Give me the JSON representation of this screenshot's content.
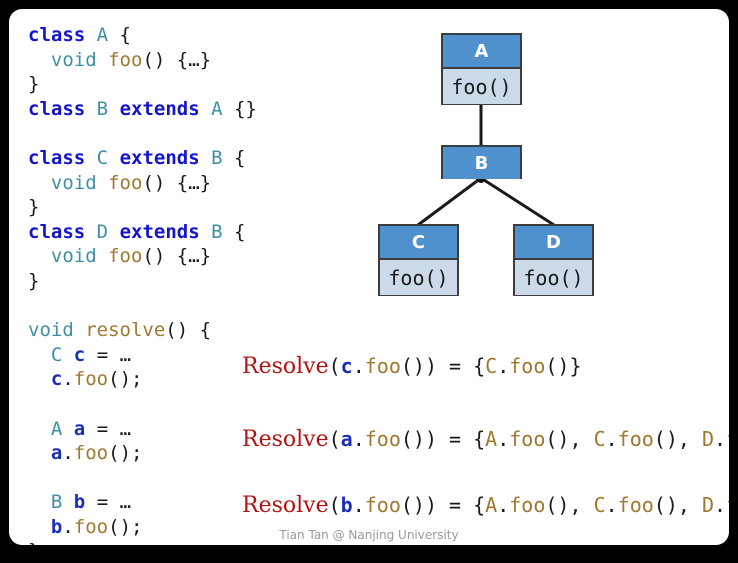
{
  "slide": {
    "footer": "Tian Tan @ Nanjing University",
    "colors": {
      "node_header": "#4f91cd",
      "node_body": "#ccd9e8",
      "node_border": "#3d3d3d",
      "resolve_red": "#b31212",
      "keyword_blue": "#1414cf",
      "type_teal": "#3f8fa5",
      "method_tan": "#a07830",
      "variable_navy": "#1a2fb8",
      "background": "#000000",
      "canvas": "#ffffff"
    }
  },
  "code": {
    "lines": [
      {
        "tokens": [
          {
            "t": "class",
            "c": "kw"
          },
          {
            "t": " ",
            "c": "pun"
          },
          {
            "t": "A",
            "c": "type"
          },
          {
            "t": " {",
            "c": "pun"
          }
        ]
      },
      {
        "tokens": [
          {
            "t": "  ",
            "c": "pun"
          },
          {
            "t": "void",
            "c": "type"
          },
          {
            "t": " ",
            "c": "pun"
          },
          {
            "t": "foo",
            "c": "fn"
          },
          {
            "t": "() {…}",
            "c": "pun"
          }
        ]
      },
      {
        "tokens": [
          {
            "t": "}",
            "c": "pun"
          }
        ]
      },
      {
        "tokens": [
          {
            "t": "class",
            "c": "kw"
          },
          {
            "t": " ",
            "c": "pun"
          },
          {
            "t": "B",
            "c": "type"
          },
          {
            "t": " ",
            "c": "pun"
          },
          {
            "t": "extends",
            "c": "kw"
          },
          {
            "t": " ",
            "c": "pun"
          },
          {
            "t": "A",
            "c": "type"
          },
          {
            "t": " {}",
            "c": "pun"
          }
        ]
      },
      {
        "tokens": []
      },
      {
        "tokens": [
          {
            "t": "class",
            "c": "kw"
          },
          {
            "t": " ",
            "c": "pun"
          },
          {
            "t": "C",
            "c": "type"
          },
          {
            "t": " ",
            "c": "pun"
          },
          {
            "t": "extends",
            "c": "kw"
          },
          {
            "t": " ",
            "c": "pun"
          },
          {
            "t": "B",
            "c": "type"
          },
          {
            "t": " {",
            "c": "pun"
          }
        ]
      },
      {
        "tokens": [
          {
            "t": "  ",
            "c": "pun"
          },
          {
            "t": "void",
            "c": "type"
          },
          {
            "t": " ",
            "c": "pun"
          },
          {
            "t": "foo",
            "c": "fn"
          },
          {
            "t": "() {…}",
            "c": "pun"
          }
        ]
      },
      {
        "tokens": [
          {
            "t": "}",
            "c": "pun"
          }
        ]
      },
      {
        "tokens": [
          {
            "t": "class",
            "c": "kw"
          },
          {
            "t": " ",
            "c": "pun"
          },
          {
            "t": "D",
            "c": "type"
          },
          {
            "t": " ",
            "c": "pun"
          },
          {
            "t": "extends",
            "c": "kw"
          },
          {
            "t": " ",
            "c": "pun"
          },
          {
            "t": "B",
            "c": "type"
          },
          {
            "t": " {",
            "c": "pun"
          }
        ]
      },
      {
        "tokens": [
          {
            "t": "  ",
            "c": "pun"
          },
          {
            "t": "void",
            "c": "type"
          },
          {
            "t": " ",
            "c": "pun"
          },
          {
            "t": "foo",
            "c": "fn"
          },
          {
            "t": "() {…}",
            "c": "pun"
          }
        ]
      },
      {
        "tokens": [
          {
            "t": "}",
            "c": "pun"
          }
        ]
      },
      {
        "tokens": []
      },
      {
        "tokens": [
          {
            "t": "void",
            "c": "type"
          },
          {
            "t": " ",
            "c": "pun"
          },
          {
            "t": "resolve",
            "c": "fn"
          },
          {
            "t": "() {",
            "c": "pun"
          }
        ]
      },
      {
        "tokens": [
          {
            "t": "  ",
            "c": "pun"
          },
          {
            "t": "C",
            "c": "type"
          },
          {
            "t": " ",
            "c": "pun"
          },
          {
            "t": "c",
            "c": "var"
          },
          {
            "t": " = …",
            "c": "pun"
          }
        ]
      },
      {
        "tokens": [
          {
            "t": "  ",
            "c": "pun"
          },
          {
            "t": "c",
            "c": "var"
          },
          {
            "t": ".",
            "c": "pun"
          },
          {
            "t": "foo",
            "c": "fn"
          },
          {
            "t": "();",
            "c": "pun"
          }
        ]
      },
      {
        "tokens": []
      },
      {
        "tokens": [
          {
            "t": "  ",
            "c": "pun"
          },
          {
            "t": "A",
            "c": "type"
          },
          {
            "t": " ",
            "c": "pun"
          },
          {
            "t": "a",
            "c": "var"
          },
          {
            "t": " = …",
            "c": "pun"
          }
        ]
      },
      {
        "tokens": [
          {
            "t": "  ",
            "c": "pun"
          },
          {
            "t": "a",
            "c": "var"
          },
          {
            "t": ".",
            "c": "pun"
          },
          {
            "t": "foo",
            "c": "fn"
          },
          {
            "t": "();",
            "c": "pun"
          }
        ]
      },
      {
        "tokens": []
      },
      {
        "tokens": [
          {
            "t": "  ",
            "c": "pun"
          },
          {
            "t": "B",
            "c": "type"
          },
          {
            "t": " ",
            "c": "pun"
          },
          {
            "t": "b",
            "c": "var"
          },
          {
            "t": " = …",
            "c": "pun"
          }
        ]
      },
      {
        "tokens": [
          {
            "t": "  ",
            "c": "pun"
          },
          {
            "t": "b",
            "c": "var"
          },
          {
            "t": ".",
            "c": "pun"
          },
          {
            "t": "foo",
            "c": "fn"
          },
          {
            "t": "();",
            "c": "pun"
          }
        ]
      },
      {
        "tokens": [
          {
            "t": "}",
            "c": "pun"
          }
        ]
      }
    ]
  },
  "resolves": [
    {
      "id": "res1",
      "label": "Resolve",
      "receiver": "c",
      "call": ".foo())",
      "open": "(",
      "equals": " = ",
      "result": "{C.foo()}",
      "result_tokens": [
        {
          "t": "{",
          "c": "eq"
        },
        {
          "t": "C",
          "c": "c"
        },
        {
          "t": ".",
          "c": "eq"
        },
        {
          "t": "foo",
          "c": "f"
        },
        {
          "t": "()}",
          "c": "eq"
        }
      ]
    },
    {
      "id": "res2",
      "label": "Resolve",
      "receiver": "a",
      "call": ".foo())",
      "open": "(",
      "equals": " = ",
      "result": "{A.foo(),C.foo(),D.foo()}",
      "result_tokens": [
        {
          "t": "{",
          "c": "eq"
        },
        {
          "t": "A",
          "c": "c"
        },
        {
          "t": ".",
          "c": "eq"
        },
        {
          "t": "foo",
          "c": "f"
        },
        {
          "t": "(), ",
          "c": "eq"
        },
        {
          "t": "C",
          "c": "c"
        },
        {
          "t": ".",
          "c": "eq"
        },
        {
          "t": "foo",
          "c": "f"
        },
        {
          "t": "(), ",
          "c": "eq"
        },
        {
          "t": "D",
          "c": "c"
        },
        {
          "t": ".",
          "c": "eq"
        },
        {
          "t": "foo",
          "c": "f"
        },
        {
          "t": "()}",
          "c": "eq"
        }
      ]
    },
    {
      "id": "res3",
      "label": "Resolve",
      "receiver": "b",
      "call": ".foo())",
      "open": "(",
      "equals": " = ",
      "result": "{A.foo(),C.foo(),D.foo()}",
      "result_tokens": [
        {
          "t": "{",
          "c": "eq"
        },
        {
          "t": "A",
          "c": "c"
        },
        {
          "t": ".",
          "c": "eq"
        },
        {
          "t": "foo",
          "c": "f"
        },
        {
          "t": "(), ",
          "c": "eq"
        },
        {
          "t": "C",
          "c": "c"
        },
        {
          "t": ".",
          "c": "eq"
        },
        {
          "t": "foo",
          "c": "f"
        },
        {
          "t": "(), ",
          "c": "eq"
        },
        {
          "t": "D",
          "c": "c"
        },
        {
          "t": ".",
          "c": "eq"
        },
        {
          "t": "foo",
          "c": "f"
        },
        {
          "t": "()}",
          "c": "eq"
        }
      ]
    }
  ],
  "diagram": {
    "nodes": [
      {
        "id": "nodeA",
        "name": "A",
        "method": "foo()",
        "has_method": true
      },
      {
        "id": "nodeB",
        "name": "B",
        "method": "",
        "has_method": false
      },
      {
        "id": "nodeC",
        "name": "C",
        "method": "foo()",
        "has_method": true
      },
      {
        "id": "nodeD",
        "name": "D",
        "method": "foo()",
        "has_method": true
      }
    ],
    "edges": [
      {
        "from": "A",
        "to": "B"
      },
      {
        "from": "B",
        "to": "C"
      },
      {
        "from": "B",
        "to": "D"
      }
    ]
  }
}
